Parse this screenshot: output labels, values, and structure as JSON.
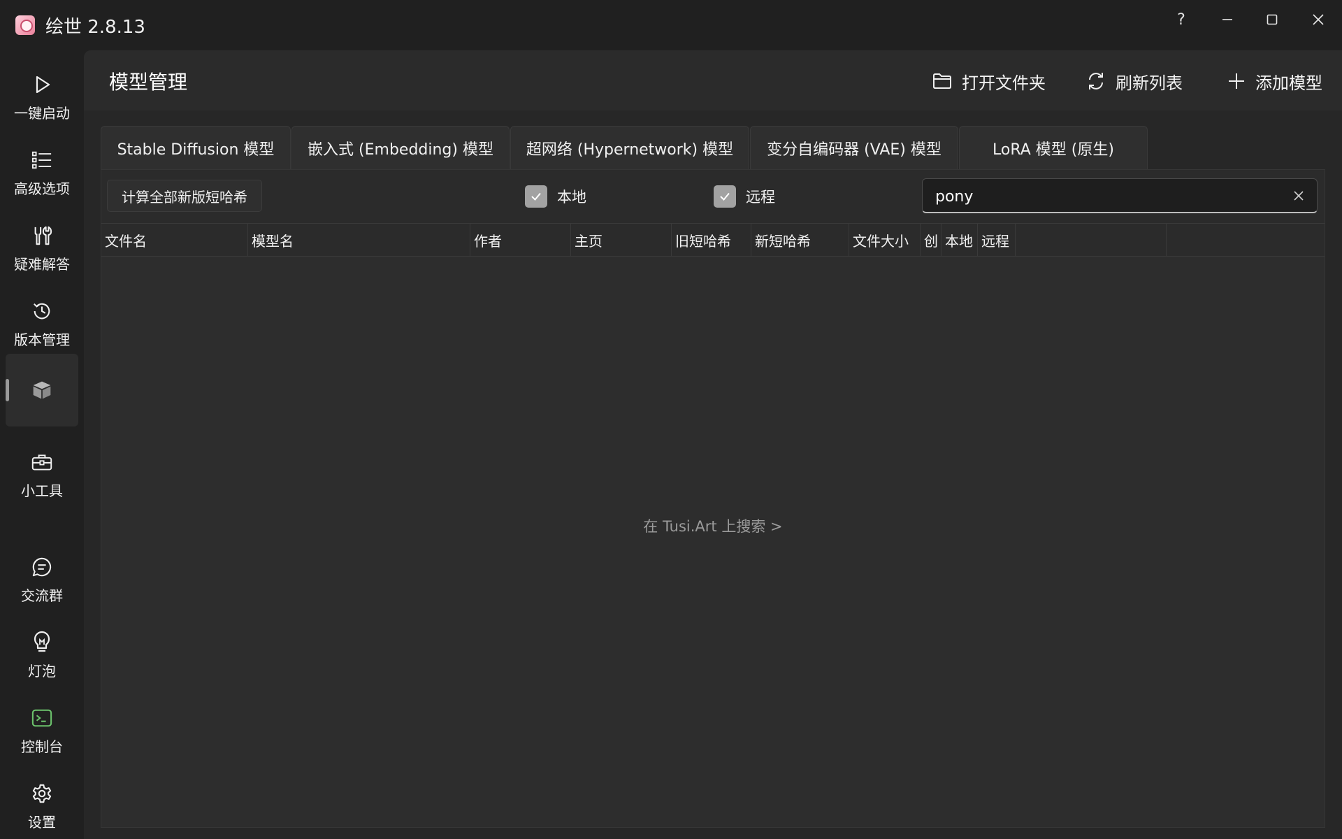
{
  "window": {
    "title": "绘世 2.8.13",
    "help_glyph": "?",
    "buttons": [
      "help-icon",
      "minimize-icon",
      "maximize-icon",
      "close-icon"
    ]
  },
  "nav": {
    "items": [
      {
        "label": "一键启动",
        "icon": "play-icon"
      },
      {
        "label": "高级选项",
        "icon": "list-icon"
      },
      {
        "label": "疑难解答",
        "icon": "wrench-icon"
      },
      {
        "label": "版本管理",
        "icon": "history-icon"
      },
      {
        "label": "",
        "icon": "box-icon",
        "active": true
      },
      {
        "label": "小工具",
        "icon": "toolbox-icon"
      },
      {
        "label": "交流群",
        "icon": "chat-icon"
      },
      {
        "label": "灯泡",
        "icon": "lightbulb-icon"
      },
      {
        "label": "控制台",
        "icon": "terminal-icon"
      },
      {
        "label": "设置",
        "icon": "gear-icon"
      }
    ]
  },
  "header": {
    "title": "模型管理",
    "open_folder": "打开文件夹",
    "refresh": "刷新列表",
    "add_model": "添加模型"
  },
  "tabs": [
    "Stable Diffusion 模型",
    "嵌入式 (Embedding) 模型",
    "超网络 (Hypernetwork) 模型",
    "变分自编码器 (VAE) 模型",
    "LoRA 模型 (原生)"
  ],
  "toolbar": {
    "calc_label": "计算全部新版短哈希",
    "local_label": "本地",
    "local_checked": true,
    "remote_label": "远程",
    "remote_checked": true,
    "search_value": "pony"
  },
  "table": {
    "columns": [
      "文件名",
      "模型名",
      "作者",
      "主页",
      "旧短哈希",
      "新短哈希",
      "文件大小",
      "创",
      "本地",
      "远程",
      ""
    ],
    "empty_link": "在 Tusi.Art 上搜索 >"
  },
  "colors": {
    "background": "#202020",
    "panel": "#272727",
    "checkbox": "#a2a2a2",
    "terminal_accent": "#6cc36c"
  }
}
